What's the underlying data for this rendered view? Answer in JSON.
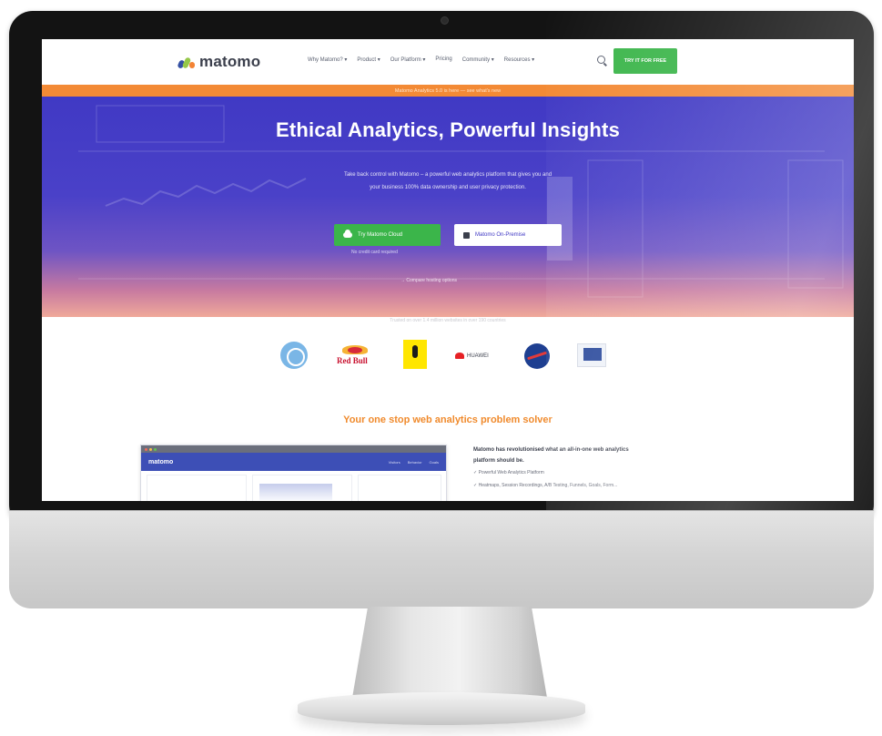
{
  "site": {
    "logo": "matomo",
    "logo_colors": [
      "#3450a3",
      "#95c748",
      "#f38334"
    ]
  },
  "nav": {
    "items": [
      "Why Matomo? ▾",
      "Product ▾",
      "Our Platform ▾",
      "Pricing",
      "Community ▾",
      "Resources ▾"
    ],
    "search_icon": "search-icon",
    "cta_label": "TRY IT FOR FREE"
  },
  "announcement": {
    "text": "Matomo Analytics 5.0 is here — see what's new"
  },
  "hero": {
    "title": "Ethical Analytics, Powerful Insights",
    "subtitle_line1": "Take back control with Matomo – a powerful web analytics platform that gives you and",
    "subtitle_line2": "your business 100% data ownership and user privacy protection.",
    "primary_button": "Try Matomo Cloud",
    "primary_icon": "cloud-icon",
    "primary_note": "No credit card required",
    "secondary_button": "Matomo On-Premise",
    "secondary_icon": "server-icon",
    "compare_link": "→ Compare hosting options"
  },
  "trusted": {
    "text": "Trusted on over 1.4 million websites in over 190 countries",
    "logos": [
      "un-logo",
      "redbull-logo",
      "amnesty-logo",
      "huawei-logo",
      "nasa-logo",
      "eu-logo"
    ],
    "redbull_word": "Red Bull",
    "huawei_word": "HUAWEI"
  },
  "section": {
    "title": "Your one stop web analytics problem solver",
    "preview_brand": "matomo",
    "preview_menu": [
      "Visitors",
      "Behavior",
      "Goals"
    ],
    "intro_line1": "Matomo has revolutionised what an all-in-one web analytics",
    "intro_line2": "platform should be.",
    "features": [
      "✓ Powerful Web Analytics Platform",
      "✓ Heatmaps, Session Recordings, A/B Testing, Funnels, Goals, Form..."
    ]
  },
  "colors": {
    "hero_top": "#4039c4",
    "accent_green": "#3bb54a",
    "accent_orange": "#f38a35",
    "bezel": "#131313"
  }
}
